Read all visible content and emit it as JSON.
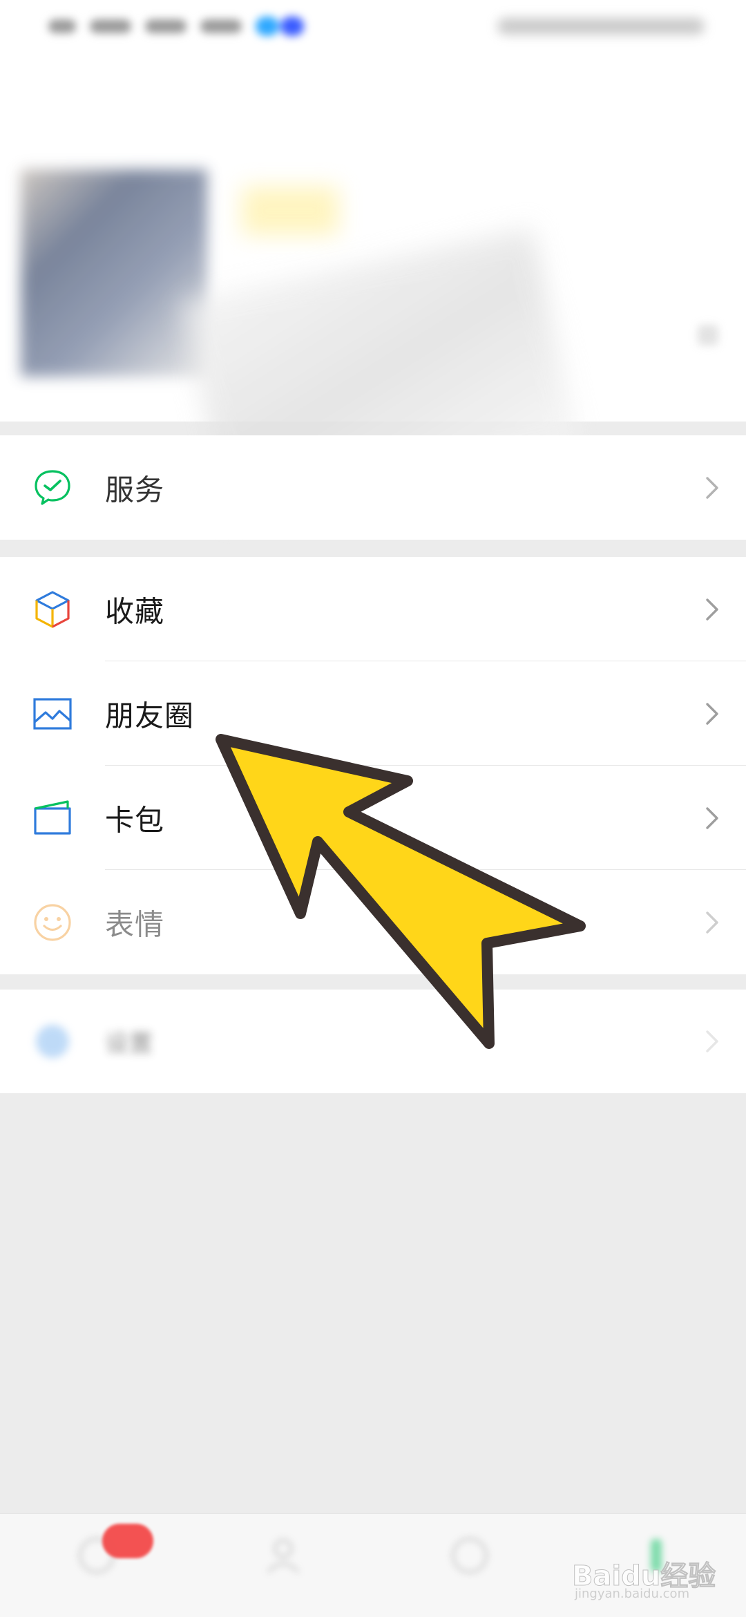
{
  "menu": {
    "services": {
      "label": "服务",
      "icon": "services-icon"
    },
    "favorites": {
      "label": "收藏",
      "icon": "favorites-cube-icon"
    },
    "moments": {
      "label": "朋友圈",
      "icon": "moments-picture-icon"
    },
    "cards": {
      "label": "卡包",
      "icon": "card-wallet-icon"
    },
    "stickers": {
      "label": "表情",
      "icon": "sticker-smiley-icon"
    },
    "settings": {
      "label": "设置",
      "icon": "settings-icon"
    }
  },
  "watermark": {
    "text": "Baidu经验",
    "sub": "jingyan.baidu.com"
  },
  "colors": {
    "accent_green": "#07c160",
    "pointer_yellow": "#ffd619",
    "pointer_outline": "#3a302e",
    "badge_red": "#f34a4a"
  }
}
